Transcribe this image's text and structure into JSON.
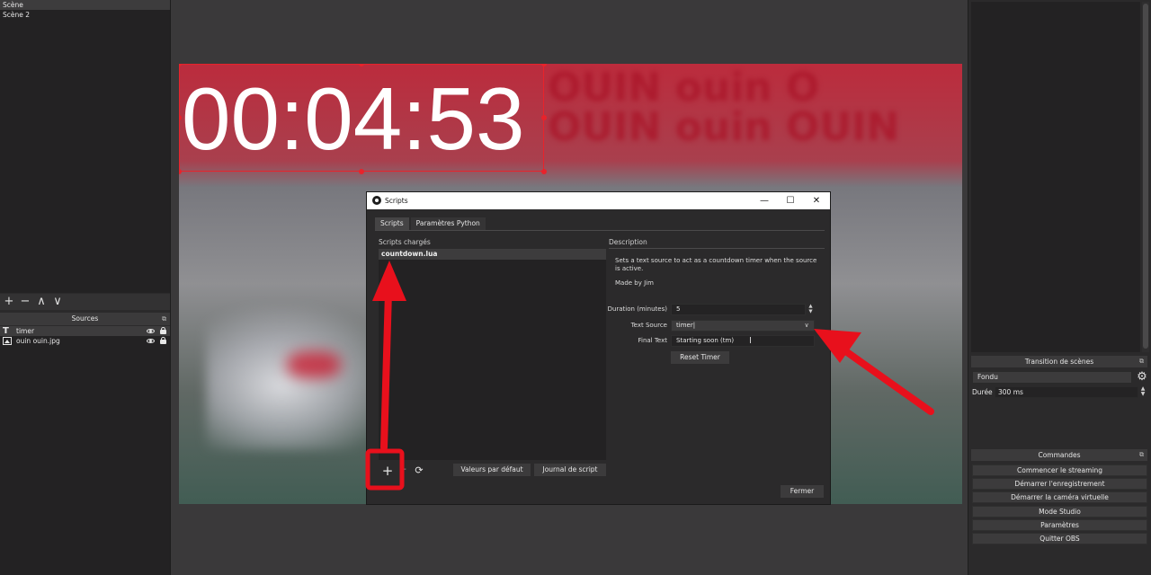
{
  "scenes": {
    "items": [
      "Scène",
      "Scène 2"
    ]
  },
  "scene_toolbar": {
    "add": "+",
    "remove": "−",
    "up": "∧",
    "down": "∨"
  },
  "sources": {
    "title": "Sources",
    "items": [
      "timer",
      "ouin ouin.jpg"
    ]
  },
  "preview": {
    "timer_text": "00:04:53",
    "background_text": "OUIN ouin O\nOUIN ouin OUIN"
  },
  "dialog": {
    "title": "Scripts",
    "tabs": [
      "Scripts",
      "Paramètres Python"
    ],
    "loaded_scripts_label": "Scripts chargés",
    "scripts": [
      "countdown.lua"
    ],
    "add_glyph": "+",
    "remove_glyph": "-",
    "defaults_button": "Valeurs par défaut",
    "log_button": "Journal de script",
    "description_label": "Description",
    "description_text": "Sets a text source to act as a countdown timer when the source is active.",
    "made_by": "Made by Jim",
    "properties": {
      "duration_label": "Duration (minutes)",
      "duration_value": "5",
      "text_source_label": "Text Source",
      "text_source_value": "timer|",
      "final_text_label": "Final Text",
      "final_text_value": "Starting soon (tm)"
    },
    "reset_button": "Reset Timer",
    "close_button": "Fermer"
  },
  "transitions": {
    "title": "Transition de scènes",
    "selected": "Fondu",
    "duration_label": "Durée",
    "duration_value": "300 ms"
  },
  "commands": {
    "title": "Commandes",
    "buttons": [
      "Commencer le streaming",
      "Démarrer l'enregistrement",
      "Démarrer la caméra virtuelle",
      "Mode Studio",
      "Paramètres",
      "Quitter OBS"
    ]
  },
  "colors": {
    "annotation_red": "#e8101c",
    "selection_red": "#e8232b",
    "panel_bg": "#2b2a2b"
  }
}
